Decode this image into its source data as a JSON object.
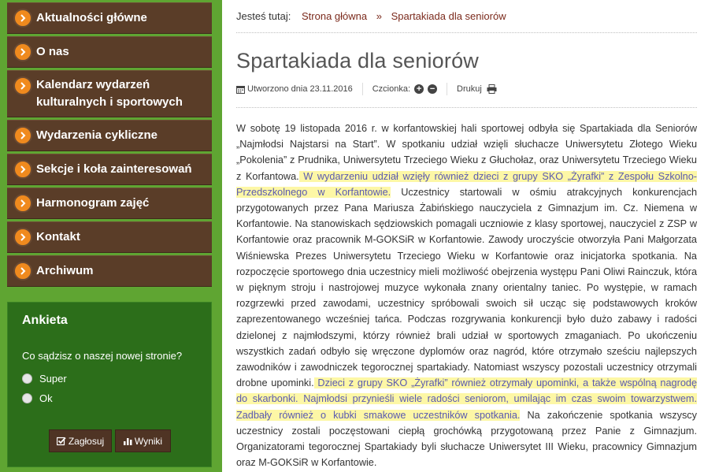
{
  "sidebar": {
    "menu": [
      {
        "label": "Aktualności główne"
      },
      {
        "label": "O nas"
      },
      {
        "label": "Kalendarz wydarzeń kulturalnych i sportowych"
      },
      {
        "label": "Wydarzenia cykliczne"
      },
      {
        "label": "Sekcje i koła zainteresowań"
      },
      {
        "label": "Harmonogram zajęć"
      },
      {
        "label": "Kontakt"
      },
      {
        "label": "Archiwum"
      }
    ],
    "poll": {
      "title": "Ankieta",
      "question": "Co sądzisz o naszej nowej stronie?",
      "options": [
        "Super",
        "Ok"
      ],
      "vote_label": "Zagłosuj",
      "results_label": "Wyniki"
    }
  },
  "breadcrumb": {
    "prefix": "Jesteś tutaj:",
    "home": "Strona główna",
    "separator": "»",
    "current": "Spartakiada dla seniorów"
  },
  "article": {
    "title": "Spartakiada dla seniorów",
    "created": "Utworzono dnia 23.11.2016",
    "font_label": "Czcionka:",
    "print_label": "Drukuj",
    "segments": [
      {
        "text": "W sobotę 19 listopada 2016 r. w korfantowskiej hali sportowej odbyła się Spartakiada dla Seniorów „Najmłodsi Najstarsi na Start”. W spotkaniu udział wzięli słuchacze Uniwersytetu Złotego Wieku „Pokolenia” z Prudnika, Uniwersytetu Trzeciego Wieku z Głuchołaz, oraz Uniwersytetu Trzeciego Wieku z Korfantowa.",
        "highlight": false
      },
      {
        "text": " W wydarzeniu udział wzięły również dzieci z grupy SKO „Żyrafki” z Zespołu Szkolno-Przedszkolnego w Korfantowie.",
        "highlight": true
      },
      {
        "text": " Uczestnicy startowali w ośmiu atrakcyjnych konkurencjach przygotowanych przez Pana Mariusza Żabińskiego nauczyciela z Gimnazjum im. Cz. Niemena w Korfantowie. Na stanowiskach sędziowskich pomagali uczniowie z klasy sportowej, nauczyciel z ZSP w Korfantowie oraz pracownik M-GOKSiR w Korfantowie. Zawody uroczyście otworzyła Pani Małgorzata Wiśniewska Prezes Uniwersytetu Trzeciego Wieku w Korfantowie oraz inicjatorka spotkania. Na rozpoczęcie sportowego dnia uczestnicy mieli możliwość obejrzenia występu Pani Oliwi Rainczuk, która w pięknym stroju i nastrojowej muzyce wykonała znany orientalny taniec. Po występie, w ramach rozgrzewki przed zawodami, uczestnicy spróbowali swoich sił ucząc się podstawowych kroków zaprezentowanego wcześniej tańca. Podczas rozgrywania konkurencji było dużo zabawy i radości dzielonej z najmłodszymi, którzy również brali udział w sportowych zmaganiach. Po ukończeniu wszystkich zadań odbyło się wręczone dyplomów oraz nagród, które otrzymało sześciu najlepszych zawodników i zawodniczek tegorocznej spartakiady. Natomiast wszyscy pozostali uczestnicy otrzymali drobne upominki.",
        "highlight": false
      },
      {
        "text": " Dzieci z grupy SKO „Żyrafki” również otrzymały upominki, a także wspólną nagrodę do skarbonki. Najmłodsi przynieśli wiele radości seniorom, umilając im czas swoim towarzystwem. Zadbały również o kubki smakowe uczestników spotkania.",
        "highlight": true
      },
      {
        "text": " Na zakończenie spotkania wszyscy uczestnicy zostali poczęstowani ciepłą grochówką przygotowaną przez Panie z Gimnazjum. Organizatorami tegorocznej Spartakiady byli słuchacze Uniwersytet III Wieku, pracownicy Gimnazjum oraz M-GOKSiR w Korfantowie.",
        "highlight": false
      }
    ]
  },
  "colors": {
    "page_bg": "#5fa532",
    "menu_bg": "#5a3d28",
    "bullet": "#f08a1e",
    "poll_bg": "#2c6e1a",
    "breadcrumb_link": "#7b2a1c",
    "highlight": "#fdf7a6"
  }
}
